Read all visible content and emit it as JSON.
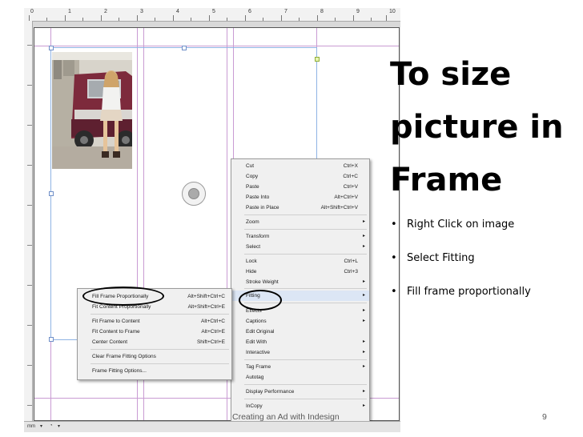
{
  "slide": {
    "title_lines": [
      "To size",
      "picture in",
      "Frame"
    ],
    "bullets": [
      "Right Click on image",
      "Select  Fitting",
      "Fill frame proportionally"
    ],
    "footer": "Creating an Ad with Indesign",
    "page_number": "9"
  },
  "screenshot": {
    "ruler_numbers": [
      "0",
      "1",
      "2",
      "3",
      "4",
      "5",
      "6",
      "7",
      "8",
      "9",
      "10"
    ],
    "status_unit": "mm",
    "context_menu": {
      "items": [
        {
          "label": "Cut",
          "shortcut": "Ctrl+X"
        },
        {
          "label": "Copy",
          "shortcut": "Ctrl+C"
        },
        {
          "label": "Paste",
          "shortcut": "Ctrl+V"
        },
        {
          "label": "Paste Into",
          "shortcut": "Alt+Ctrl+V"
        },
        {
          "label": "Paste in Place",
          "shortcut": "Alt+Shift+Ctrl+V"
        },
        {
          "label": "Zoom",
          "shortcut": ""
        },
        {
          "label": "Transform",
          "shortcut": ""
        },
        {
          "label": "Select",
          "shortcut": ""
        },
        {
          "label": "Lock",
          "shortcut": "Ctrl+L"
        },
        {
          "label": "Hide",
          "shortcut": "Ctrl+3"
        },
        {
          "label": "Stroke Weight",
          "shortcut": ""
        },
        {
          "label": "Fitting",
          "shortcut": ""
        },
        {
          "label": "Effects",
          "shortcut": ""
        },
        {
          "label": "Captions",
          "shortcut": ""
        },
        {
          "label": "Edit Original",
          "shortcut": ""
        },
        {
          "label": "Edit With",
          "shortcut": ""
        },
        {
          "label": "Interactive",
          "shortcut": ""
        },
        {
          "label": "Tag Frame",
          "shortcut": ""
        },
        {
          "label": "Autotag",
          "shortcut": ""
        },
        {
          "label": "Display Performance",
          "shortcut": ""
        },
        {
          "label": "InCopy",
          "shortcut": ""
        }
      ]
    },
    "fitting_submenu": {
      "items": [
        {
          "label": "Fill Frame Proportionally",
          "shortcut": "Alt+Shift+Ctrl+C"
        },
        {
          "label": "Fit Content Proportionally",
          "shortcut": "Alt+Shift+Ctrl+E"
        },
        {
          "label": "Fit Frame to Content",
          "shortcut": "Alt+Ctrl+C"
        },
        {
          "label": "Fit Content to Frame",
          "shortcut": "Alt+Ctrl+E"
        },
        {
          "label": "Center Content",
          "shortcut": "Shift+Ctrl+E"
        },
        {
          "label": "Clear Frame Fitting Options",
          "shortcut": ""
        },
        {
          "label": "Frame Fitting Options...",
          "shortcut": ""
        }
      ]
    }
  }
}
